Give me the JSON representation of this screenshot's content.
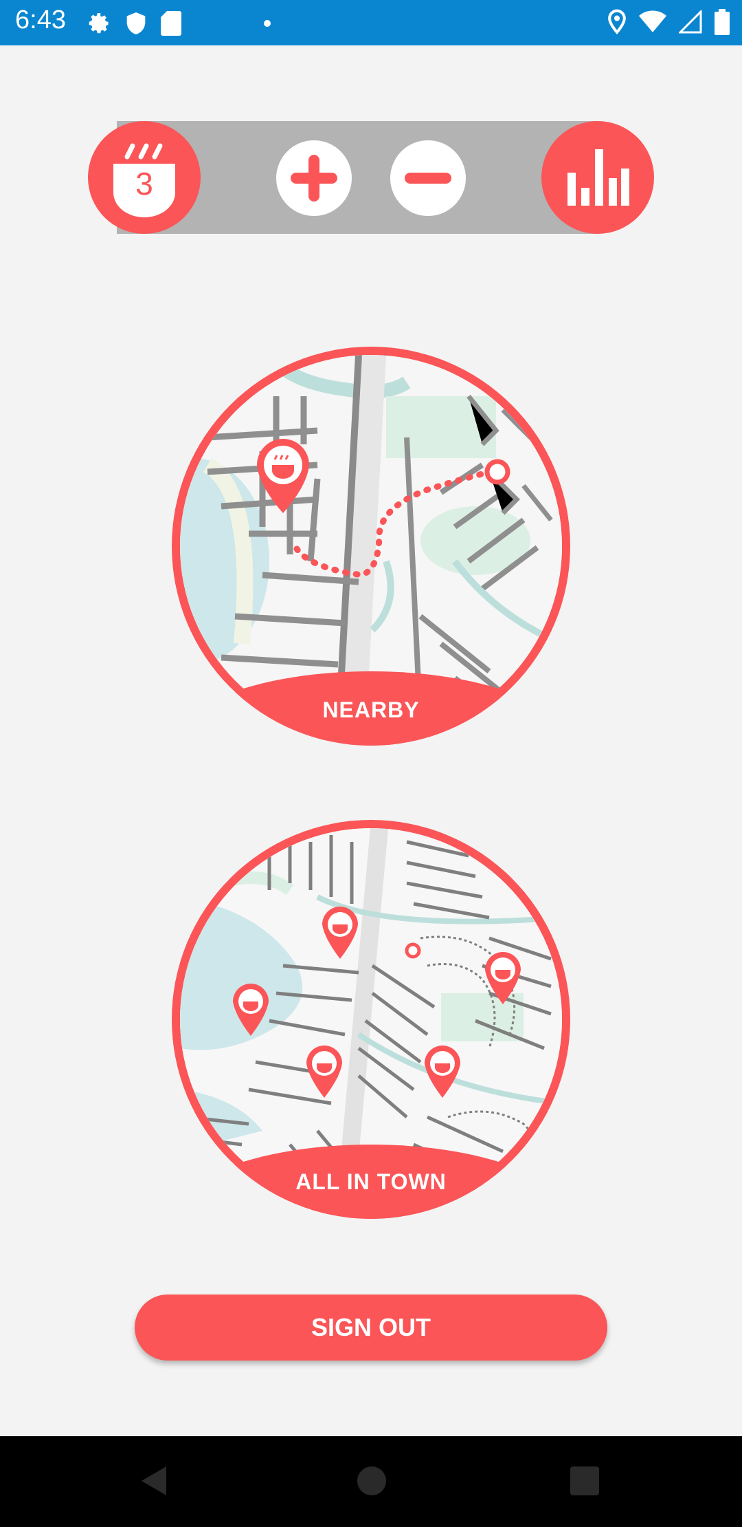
{
  "status_bar": {
    "time": "6:43",
    "left_icons": [
      "gear-icon",
      "shield-icon",
      "sd-card-icon"
    ],
    "right_icons": [
      "location-icon",
      "wifi-icon",
      "signal-icon",
      "battery-icon"
    ]
  },
  "toolbar": {
    "cup_count": "3",
    "icons": [
      "coffee-cup-icon",
      "plus-icon",
      "minus-icon",
      "bar-chart-icon"
    ]
  },
  "maps": {
    "nearby_label": "NEARBY",
    "alltown_label": "ALL IN TOWN"
  },
  "actions": {
    "signout_label": "SIGN OUT"
  },
  "colors": {
    "accent": "#fb5557",
    "status_bar": "#0a86d1",
    "track": "#b3b3b3",
    "background": "#f3f3f3"
  }
}
